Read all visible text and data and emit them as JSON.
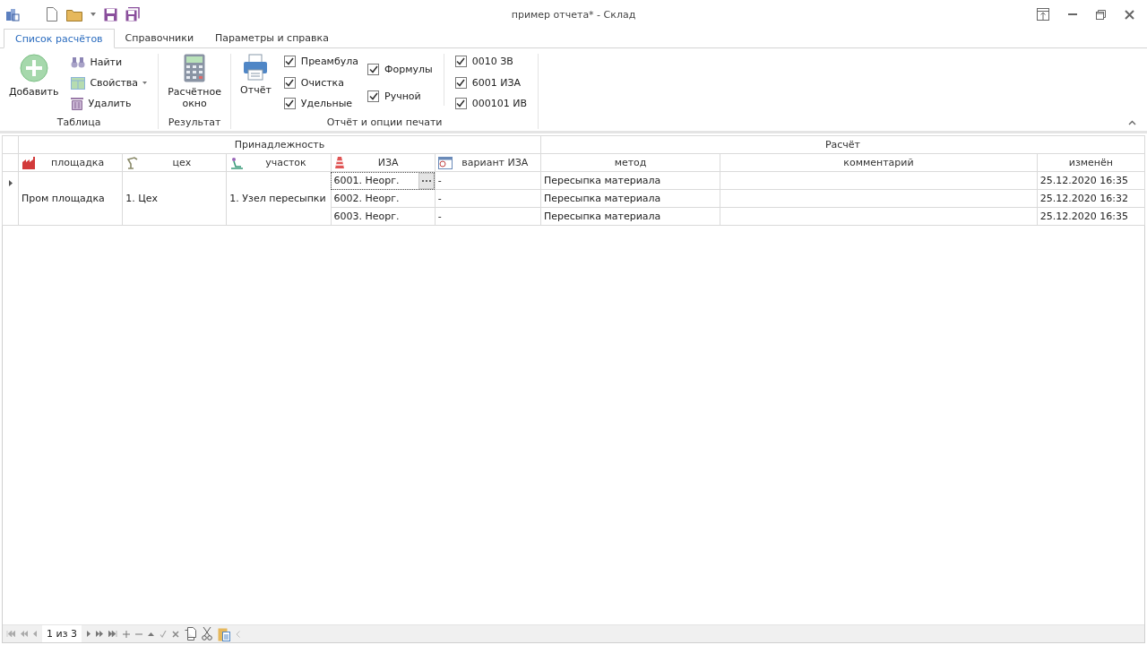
{
  "window": {
    "title": "пример отчета* - Склад"
  },
  "tabs": [
    {
      "label": "Список расчётов",
      "selected": true
    },
    {
      "label": "Справочники",
      "selected": false
    },
    {
      "label": "Параметры и справка",
      "selected": false
    }
  ],
  "ribbon": {
    "table_group": {
      "label": "Таблица",
      "add": "Добавить",
      "find": "Найти",
      "properties": "Свойства",
      "delete": "Удалить"
    },
    "result_group": {
      "label": "Результат",
      "calc_window": "Расчётное окно"
    },
    "report_group": {
      "label": "Отчёт и опции печати",
      "report": "Отчёт",
      "options": [
        {
          "label": "Преамбула",
          "checked": true
        },
        {
          "label": "Очистка",
          "checked": true
        },
        {
          "label": "Удельные",
          "checked": true
        }
      ],
      "options_2": [
        {
          "label": "Формулы",
          "checked": true
        },
        {
          "label": "Ручной",
          "checked": true
        }
      ],
      "sources": [
        {
          "label": "0010 ЗВ",
          "checked": true
        },
        {
          "label": "6001 ИЗА",
          "checked": true
        },
        {
          "label": "000101 ИВ",
          "checked": true
        }
      ]
    }
  },
  "table": {
    "column_groups": [
      {
        "label": "Принадлежность",
        "columns": [
          "площадка",
          "цех",
          "участок",
          "ИЗА",
          "вариант ИЗА"
        ]
      },
      {
        "label": "Расчёт",
        "columns": [
          "метод",
          "комментарий",
          "изменён"
        ]
      }
    ],
    "groups": [
      {
        "site": "Пром площадка",
        "shop": "1. Цех",
        "section": "1. Узел пересыпки",
        "selected": true,
        "rows": [
          {
            "source": "6001. Неорг.",
            "variant": "-",
            "method": "Пересыпка материала",
            "changed": "25.12.2020 16:35",
            "focused": true
          },
          {
            "source": "6002. Неорг.",
            "variant": "-",
            "method": "Пересыпка материала",
            "changed": "25.12.2020 16:32",
            "focused": false
          },
          {
            "source": "6003. Неорг.",
            "variant": "-",
            "method": "Пересыпка материала",
            "changed": "25.12.2020 16:35",
            "focused": false
          }
        ]
      }
    ]
  },
  "navigator": {
    "position": "1 из 3"
  }
}
